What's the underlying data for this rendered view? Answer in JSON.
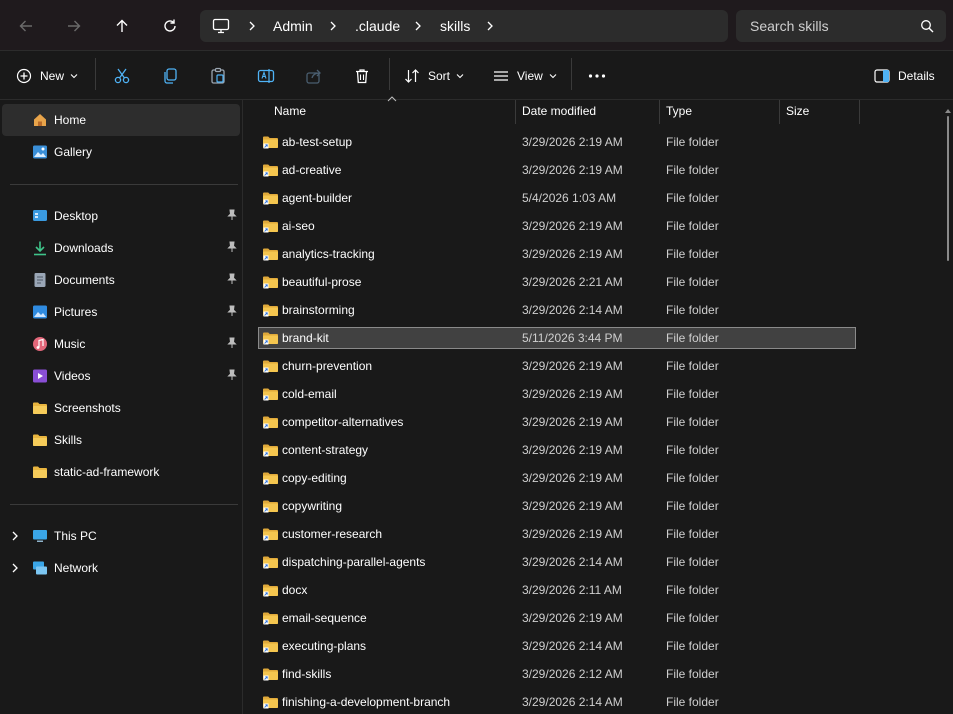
{
  "nav": {
    "back_icon": "arrow-left-icon",
    "forward_icon": "arrow-right-icon",
    "up_icon": "arrow-up-icon",
    "refresh_icon": "refresh-icon"
  },
  "address": {
    "breadcrumbs": [
      "Admin",
      ".claude",
      "skills"
    ]
  },
  "search": {
    "placeholder": "Search skills"
  },
  "toolbar": {
    "new_label": "New",
    "sort_label": "Sort",
    "view_label": "View",
    "details_label": "Details"
  },
  "sidebar": {
    "items": [
      {
        "label": "Home",
        "icon": "home-icon"
      },
      {
        "label": "Gallery",
        "icon": "gallery-icon"
      },
      {
        "label": "Desktop",
        "icon": "desktop-icon"
      },
      {
        "label": "Downloads",
        "icon": "download-icon"
      },
      {
        "label": "Documents",
        "icon": "document-icon"
      },
      {
        "label": "Pictures",
        "icon": "pictures-icon"
      },
      {
        "label": "Music",
        "icon": "music-icon"
      },
      {
        "label": "Videos",
        "icon": "videos-icon"
      },
      {
        "label": "Screenshots",
        "icon": "folder-icon"
      },
      {
        "label": "Skills",
        "icon": "folder-icon"
      },
      {
        "label": "static-ad-framework",
        "icon": "folder-icon"
      },
      {
        "label": "This PC",
        "icon": "pc-icon"
      },
      {
        "label": "Network",
        "icon": "network-icon"
      }
    ]
  },
  "columns": {
    "name": "Name",
    "date": "Date modified",
    "type": "Type",
    "size": "Size"
  },
  "files": [
    {
      "name": "ab-test-setup",
      "date": "3/29/2026 2:19 AM",
      "type": "File folder"
    },
    {
      "name": "ad-creative",
      "date": "3/29/2026 2:19 AM",
      "type": "File folder"
    },
    {
      "name": "agent-builder",
      "date": "5/4/2026 1:03 AM",
      "type": "File folder"
    },
    {
      "name": "ai-seo",
      "date": "3/29/2026 2:19 AM",
      "type": "File folder"
    },
    {
      "name": "analytics-tracking",
      "date": "3/29/2026 2:19 AM",
      "type": "File folder"
    },
    {
      "name": "beautiful-prose",
      "date": "3/29/2026 2:21 AM",
      "type": "File folder"
    },
    {
      "name": "brainstorming",
      "date": "3/29/2026 2:14 AM",
      "type": "File folder"
    },
    {
      "name": "brand-kit",
      "date": "5/11/2026 3:44 PM",
      "type": "File folder"
    },
    {
      "name": "churn-prevention",
      "date": "3/29/2026 2:19 AM",
      "type": "File folder"
    },
    {
      "name": "cold-email",
      "date": "3/29/2026 2:19 AM",
      "type": "File folder"
    },
    {
      "name": "competitor-alternatives",
      "date": "3/29/2026 2:19 AM",
      "type": "File folder"
    },
    {
      "name": "content-strategy",
      "date": "3/29/2026 2:19 AM",
      "type": "File folder"
    },
    {
      "name": "copy-editing",
      "date": "3/29/2026 2:19 AM",
      "type": "File folder"
    },
    {
      "name": "copywriting",
      "date": "3/29/2026 2:19 AM",
      "type": "File folder"
    },
    {
      "name": "customer-research",
      "date": "3/29/2026 2:19 AM",
      "type": "File folder"
    },
    {
      "name": "dispatching-parallel-agents",
      "date": "3/29/2026 2:14 AM",
      "type": "File folder"
    },
    {
      "name": "docx",
      "date": "3/29/2026 2:11 AM",
      "type": "File folder"
    },
    {
      "name": "email-sequence",
      "date": "3/29/2026 2:19 AM",
      "type": "File folder"
    },
    {
      "name": "executing-plans",
      "date": "3/29/2026 2:14 AM",
      "type": "File folder"
    },
    {
      "name": "find-skills",
      "date": "3/29/2026 2:12 AM",
      "type": "File folder"
    },
    {
      "name": "finishing-a-development-branch",
      "date": "3/29/2026 2:14 AM",
      "type": "File folder"
    }
  ],
  "selected_file": "brand-kit",
  "colors": {
    "background": "#191919",
    "titlebar": "#1f1a1d",
    "folder": "#f4c44f",
    "selection": "#414141"
  }
}
